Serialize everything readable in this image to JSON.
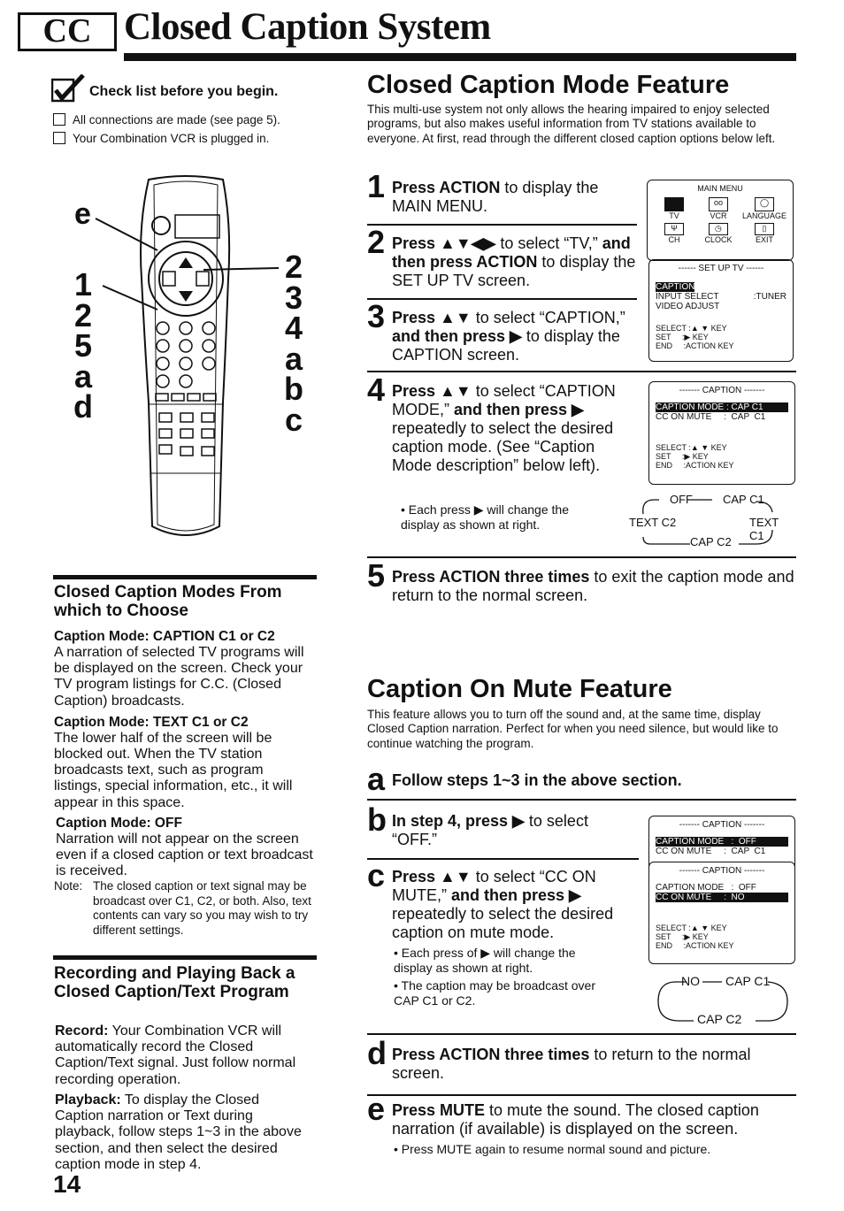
{
  "header": {
    "logo": "CC",
    "title": "Closed Caption System"
  },
  "checklist": {
    "title": "Check list before you begin.",
    "items": [
      "All connections are made (see page 5).",
      "Your Combination VCR is plugged in."
    ]
  },
  "remote": {
    "left_labels": [
      "e",
      "1",
      "2",
      "5",
      "a",
      "d"
    ],
    "right_labels": [
      "2",
      "3",
      "4",
      "a",
      "b",
      "c"
    ]
  },
  "modes": {
    "title": "Closed Caption Modes From which to Choose",
    "items": [
      {
        "heading": "Caption Mode: CAPTION C1 or C2",
        "text": "A narration of selected TV programs will be displayed on the screen. Check your TV program listings for C.C. (Closed Caption) broadcasts."
      },
      {
        "heading": "Caption Mode: TEXT C1 or C2",
        "text": "The lower half of the screen will be blocked out. When the TV station broadcasts text, such as program listings, special information, etc., it will appear in this space."
      },
      {
        "heading": "Caption Mode: OFF",
        "text": "Narration will not appear on the screen even if a closed caption or text broadcast is received."
      }
    ],
    "note_label": "Note:",
    "note": "The closed caption or text signal may be broadcast over C1, C2, or both. Also, text contents can vary so you may wish to try different settings."
  },
  "recording": {
    "title": "Recording and Playing Back a Closed Caption/Text Program",
    "record_label": "Record:",
    "record_text": "Your Combination VCR will automatically record the Closed Caption/Text signal. Just follow normal recording operation.",
    "playback_label": "Playback:",
    "playback_text": "To display the Closed Caption narration or Text during playback, follow steps 1~3 in the above section, and then select the desired caption mode in step 4."
  },
  "page_number": "14",
  "mode_feature": {
    "title": "Closed Caption Mode Feature",
    "intro": "This multi-use system not only allows the hearing impaired to enjoy selected programs, but also makes useful information from TV stations available to everyone. At first, read through the different closed caption options below left.",
    "steps": [
      {
        "num": "1",
        "b1": "Press ACTION",
        "t1": " to display the MAIN MENU."
      },
      {
        "num": "2",
        "b1": "Press ▲▼◀▶",
        "t1": " to select “TV,” ",
        "b2": "and then press ACTION",
        "t2": " to display the SET UP TV screen."
      },
      {
        "num": "3",
        "b1": "Press ▲▼",
        "t1": " to select “CAPTION,” ",
        "b2": "and then press ▶",
        "t2": " to display the CAPTION screen."
      },
      {
        "num": "4",
        "b1": "Press ▲▼",
        "t1": " to select “CAPTION MODE,” ",
        "b2": "and then press ▶",
        "t2": " repeatedly to select the desired caption mode. (See “Caption Mode description” below left)."
      },
      {
        "num": "5",
        "b1": "Press ACTION three times",
        "t1": " to exit the caption mode and return to the normal screen."
      }
    ],
    "step4_bullet": "• Each press ▶ will change the display as shown at right."
  },
  "main_menu": {
    "title": "MAIN MENU",
    "icons": [
      "TV",
      "VCR",
      "LANGUAGE",
      "CH",
      "CLOCK",
      "EXIT"
    ]
  },
  "setup_tv": {
    "title": "------ SET UP TV ------",
    "items": [
      "CAPTION",
      "INPUT SELECT",
      ":TUNER",
      "VIDEO ADJUST"
    ],
    "keys": [
      "SELECT :▲ ▼ KEY",
      "SET     :▶ KEY",
      "END     :ACTION KEY"
    ]
  },
  "caption_screen1": {
    "title": "------- CAPTION -------",
    "row1": "CAPTION MODE : CAP C1",
    "row2": "CC ON MUTE     :  CAP  C1"
  },
  "cycle1": [
    "OFF",
    "CAP C1",
    "TEXT C1",
    "CAP C2",
    "TEXT C2"
  ],
  "mute_feature": {
    "title": "Caption On Mute Feature",
    "intro": "This feature allows you to turn off the sound and, at the same time, display Closed Caption narration. Perfect for when you need silence, but would like to continue watching the program.",
    "steps": [
      {
        "letter": "a",
        "b1": "Follow steps 1~3 in the above section.",
        "t1": ""
      },
      {
        "letter": "b",
        "b1": "In step 4, press ▶",
        "t1": " to select “OFF.”"
      },
      {
        "letter": "c",
        "b1": "Press ▲▼",
        "t1": " to select “CC ON MUTE,” ",
        "b2": "and then press ▶",
        "t2": " repeatedly to select the desired caption on mute mode."
      },
      {
        "letter": "d",
        "b1": "Press ACTION three times",
        "t1": " to return to the normal screen."
      },
      {
        "letter": "e",
        "b1": "Press MUTE",
        "t1": " to mute the sound. The closed caption narration (if available) is displayed on the screen."
      }
    ],
    "c_bullets": [
      "• Each press of ▶ will change the display as shown at right.",
      "• The caption may be broadcast over CAP C1 or C2."
    ],
    "e_bullet": "• Press MUTE again to resume normal sound and picture."
  },
  "caption_screen2": {
    "title": "------- CAPTION -------",
    "row1": "CAPTION MODE   :  OFF",
    "row2": "CC ON MUTE     :  CAP  C1"
  },
  "caption_screen3": {
    "title": "------- CAPTION -------",
    "row1": "CAPTION MODE   :  OFF",
    "row2": "CC ON MUTE     :  NO"
  },
  "cycle2": [
    "NO",
    "CAP C1",
    "CAP C2"
  ]
}
